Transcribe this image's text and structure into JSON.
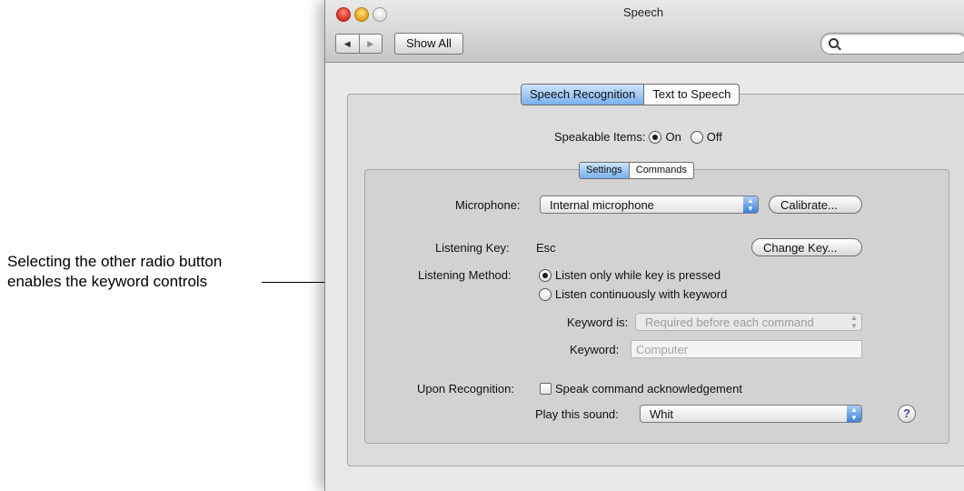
{
  "annotation": {
    "line1": "Selecting the other radio button",
    "line2": "enables the keyword controls"
  },
  "window": {
    "title": "Speech",
    "nav_back": "◀",
    "nav_forward": "▶",
    "show_all_label": "Show All",
    "search_placeholder": "",
    "search_icon": "magnifier-icon"
  },
  "main_tabs": [
    {
      "label": "Speech Recognition",
      "selected": true
    },
    {
      "label": "Text to Speech",
      "selected": false
    }
  ],
  "speakable_items": {
    "label": "Speakable Items:",
    "on_label": "On",
    "off_label": "Off",
    "selected": "On"
  },
  "sub_tabs": [
    {
      "label": "Settings",
      "selected": true
    },
    {
      "label": "Commands",
      "selected": false
    }
  ],
  "settings": {
    "microphone_label": "Microphone:",
    "microphone_value": "Internal microphone",
    "calibrate_label": "Calibrate...",
    "listening_key_label": "Listening Key:",
    "listening_key_value": "Esc",
    "change_key_label": "Change Key...",
    "listening_method_label": "Listening Method:",
    "method_option1": "Listen only while key is pressed",
    "method_option2": "Listen continuously with keyword",
    "method_selected": 1,
    "keyword_is_label": "Keyword is:",
    "keyword_is_value": "Required before each command",
    "keyword_label": "Keyword:",
    "keyword_value": "Computer",
    "upon_recognition_label": "Upon Recognition:",
    "speak_ack_label": "Speak command acknowledgement",
    "speak_ack_checked": false,
    "play_sound_label": "Play this sound:",
    "play_sound_value": "Whit",
    "help_label": "?"
  },
  "colors": {
    "selected_tab": "#78aff0",
    "window_bg": "#e8e8e8"
  }
}
